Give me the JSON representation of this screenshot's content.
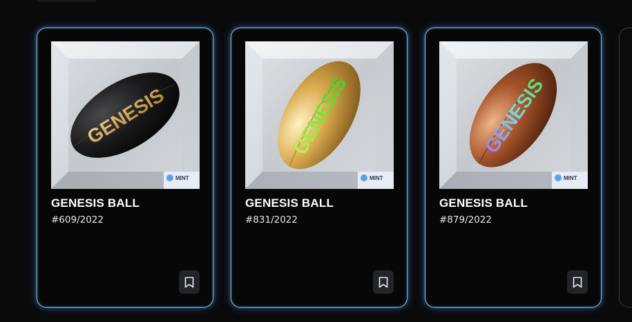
{
  "cards": [
    {
      "title": "GENESIS BALL",
      "number": "#609/2022",
      "ball": "black",
      "badge": "MINT",
      "bookmark_icon": "bookmark-icon"
    },
    {
      "title": "GENESIS BALL",
      "number": "#831/2022",
      "ball": "gold",
      "badge": "MINT",
      "bookmark_icon": "bookmark-icon"
    },
    {
      "title": "GENESIS BALL",
      "number": "#879/2022",
      "ball": "bronze",
      "badge": "MINT",
      "bookmark_icon": "bookmark-icon"
    }
  ],
  "colors": {
    "page_bg": "#0a0a0b",
    "card_border": "#7fc4e8",
    "title_text": "#ffffff",
    "bookmark_bg": "#232427"
  }
}
